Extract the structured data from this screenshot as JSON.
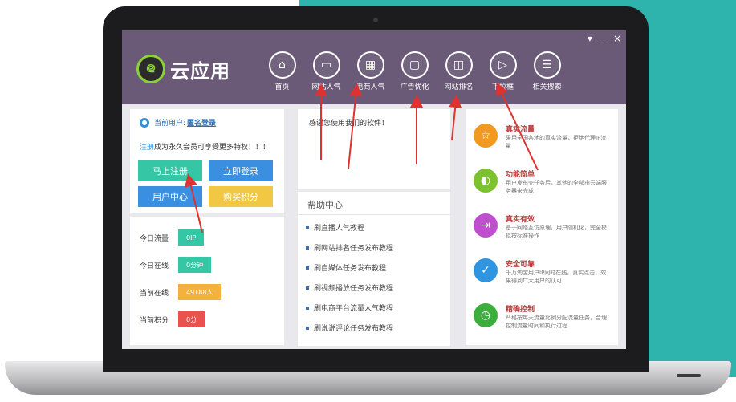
{
  "window_controls": {
    "menu": "▾",
    "minimize": "–",
    "close": "×"
  },
  "app": {
    "logo_mark": "᪤",
    "name": "云应用"
  },
  "nav": [
    {
      "label": "首页",
      "icon": "home-icon",
      "glyph": "⌂"
    },
    {
      "label": "网站人气",
      "icon": "monitor-icon",
      "glyph": "▭"
    },
    {
      "label": "电商人气",
      "icon": "store-icon",
      "glyph": "▦"
    },
    {
      "label": "广告优化",
      "icon": "image-icon",
      "glyph": "▢"
    },
    {
      "label": "网站排名",
      "icon": "chart-icon",
      "glyph": "◫"
    },
    {
      "label": "下拉框",
      "icon": "video-icon",
      "glyph": "▷"
    },
    {
      "label": "相关搜索",
      "icon": "list-icon",
      "glyph": "☰"
    }
  ],
  "user": {
    "label": "当前用户:",
    "value": "匿名登录"
  },
  "promo": {
    "link": "注册",
    "text": "成为永久会员可享受更多特权！！！"
  },
  "buttons": {
    "register": "马上注册",
    "login": "立即登录",
    "user_center": "用户中心",
    "buy_points": "购买积分"
  },
  "stats": [
    {
      "label": "今日流量",
      "value": "0IP",
      "color": "#34c6a5"
    },
    {
      "label": "今日在线",
      "value": "0分钟",
      "color": "#34c6a5"
    },
    {
      "label": "当前在线",
      "value": "49188人",
      "color": "#f2b23c"
    },
    {
      "label": "当前积分",
      "value": "0分",
      "color": "#e8534f"
    }
  ],
  "welcome": "感谢您使用我们的软件！",
  "help": {
    "title": "帮助中心",
    "items": [
      "刷直播人气教程",
      "刷网站排名任务发布教程",
      "刷自媒体任务发布教程",
      "刷视频播放任务发布教程",
      "刷电商平台流量人气教程",
      "刷说说评论任务发布教程"
    ]
  },
  "features": [
    {
      "title": "真实流量",
      "desc": "采用全国各地的真实流量，拒绝代理IP流量",
      "color": "#f09a22",
      "icon": "star-icon",
      "glyph": "☆"
    },
    {
      "title": "功能简单",
      "desc": "用户发布完任务后，其他的全部由云端服务器来完成",
      "color": "#7cc12e",
      "icon": "mouse-icon",
      "glyph": "◐"
    },
    {
      "title": "真实有效",
      "desc": "基于网络互访原理，用户随机化，完全模拟按标准操作",
      "color": "#c04fd0",
      "icon": "exit-icon",
      "glyph": "⇥"
    },
    {
      "title": "安全可靠",
      "desc": "千万淘宝用户IP同时在线，真实点击，效果得到广大用户的认可",
      "color": "#2f95e0",
      "icon": "shield-icon",
      "glyph": "✓"
    },
    {
      "title": "精确控制",
      "desc": "严格按每天流量比例分配流量任务，合理控制流量时间和执行过程",
      "color": "#3cae3c",
      "icon": "clock-icon",
      "glyph": "◷"
    }
  ]
}
